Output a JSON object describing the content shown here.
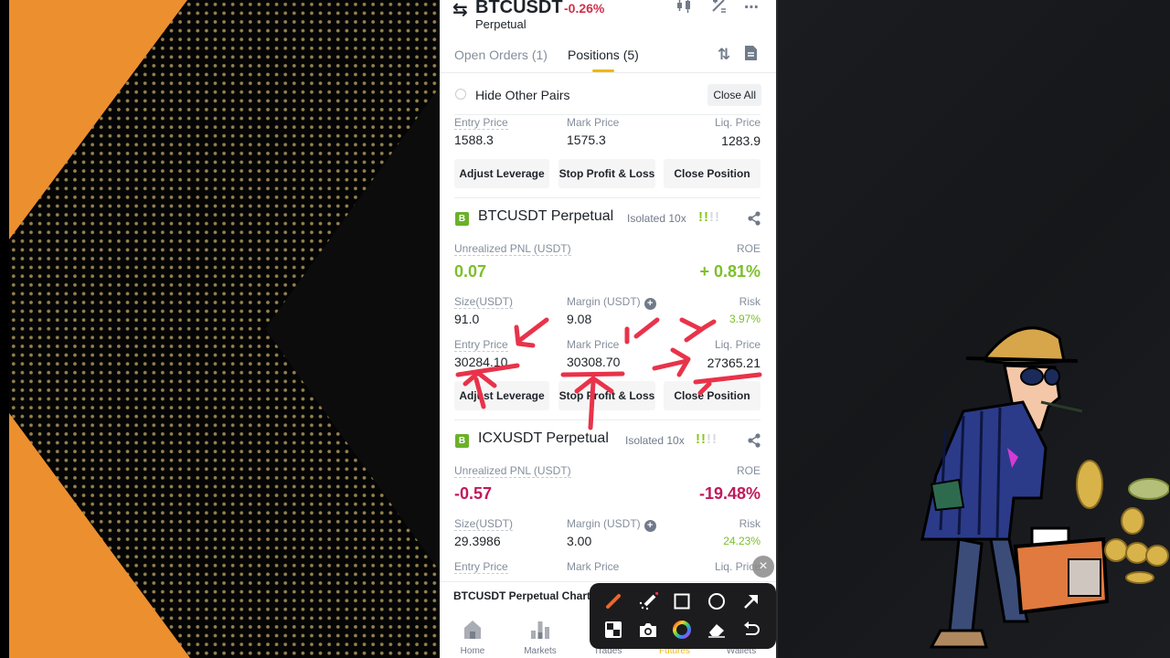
{
  "header": {
    "pair": "BTCUSDT",
    "change": "-0.26%",
    "subtitle": "Perpetual",
    "icons": [
      "candlestick-icon",
      "calculator-icon",
      "more-icon"
    ]
  },
  "tabs": [
    {
      "label": "Open Orders (1)",
      "active": false
    },
    {
      "label": "Positions (5)",
      "active": true
    }
  ],
  "filter": {
    "hide_other_pairs": "Hide Other Pairs",
    "close_all": "Close All"
  },
  "positions": [
    {
      "partial": true,
      "entry_price_label": "Entry Price",
      "entry_price": "1588.3",
      "mark_price_label": "Mark Price",
      "mark_price": "1575.3",
      "liq_price_label": "Liq. Price",
      "liq_price": "1283.9",
      "buttons": [
        "Adjust Leverage",
        "Stop Profit & Loss",
        "Close Position"
      ]
    },
    {
      "badge": "B",
      "title": "BTCUSDT Perpetual",
      "margin_mode": "Isolated 10x",
      "risk_level": "2 of 4",
      "pnl_label": "Unrealized PNL (USDT)",
      "pnl": "0.07",
      "roe_label": "ROE",
      "roe": "+ 0.81%",
      "size_label": "Size(USDT)",
      "size": "91.0",
      "margin_label": "Margin (USDT)",
      "margin": "9.08",
      "risk_label": "Risk",
      "risk": "3.97%",
      "entry_price_label": "Entry Price",
      "entry_price": "30284.10",
      "mark_price_label": "Mark Price",
      "mark_price": "30308.70",
      "liq_price_label": "Liq. Price",
      "liq_price": "27365.21",
      "buttons": [
        "Adjust Leverage",
        "Stop Profit & Loss",
        "Close Position"
      ]
    },
    {
      "badge": "B",
      "title": "ICXUSDT Perpetual",
      "margin_mode": "Isolated 10x",
      "risk_level": "2 of 4",
      "pnl_label": "Unrealized PNL (USDT)",
      "pnl": "-0.57",
      "roe_label": "ROE",
      "roe": "-19.48%",
      "size_label": "Size(USDT)",
      "size": "29.3986",
      "margin_label": "Margin (USDT)",
      "margin": "3.00",
      "risk_label": "Risk",
      "risk": "24.23%",
      "entry_price_label": "Entry Price",
      "mark_price_label": "Mark Price",
      "liq_price_label": "Liq. Price"
    }
  ],
  "bottom": {
    "chart_link": "BTCUSDT Perpetual  Chart",
    "nav": [
      {
        "label": "Home",
        "icon": "home-icon",
        "active": false
      },
      {
        "label": "Markets",
        "icon": "markets-icon",
        "active": false
      },
      {
        "label": "Trades",
        "icon": "trades-icon",
        "active": false
      },
      {
        "label": "Futures",
        "icon": "futures-icon",
        "active": true
      },
      {
        "label": "Wallets",
        "icon": "wallets-icon",
        "active": false
      }
    ]
  },
  "annotation_toolbar": {
    "tools": [
      "brush-icon",
      "laser-icon",
      "rectangle-icon",
      "circle-icon",
      "arrow-icon",
      "mosaic-icon",
      "camera-icon",
      "color-wheel-icon",
      "eraser-icon",
      "undo-icon"
    ],
    "close": "×"
  },
  "colors": {
    "positive": "#7cbf2a",
    "negative": "#c2185b",
    "accent": "#f0b90b",
    "annotation_pen": "#e8334a",
    "background_orange": "#ec8f2f"
  }
}
